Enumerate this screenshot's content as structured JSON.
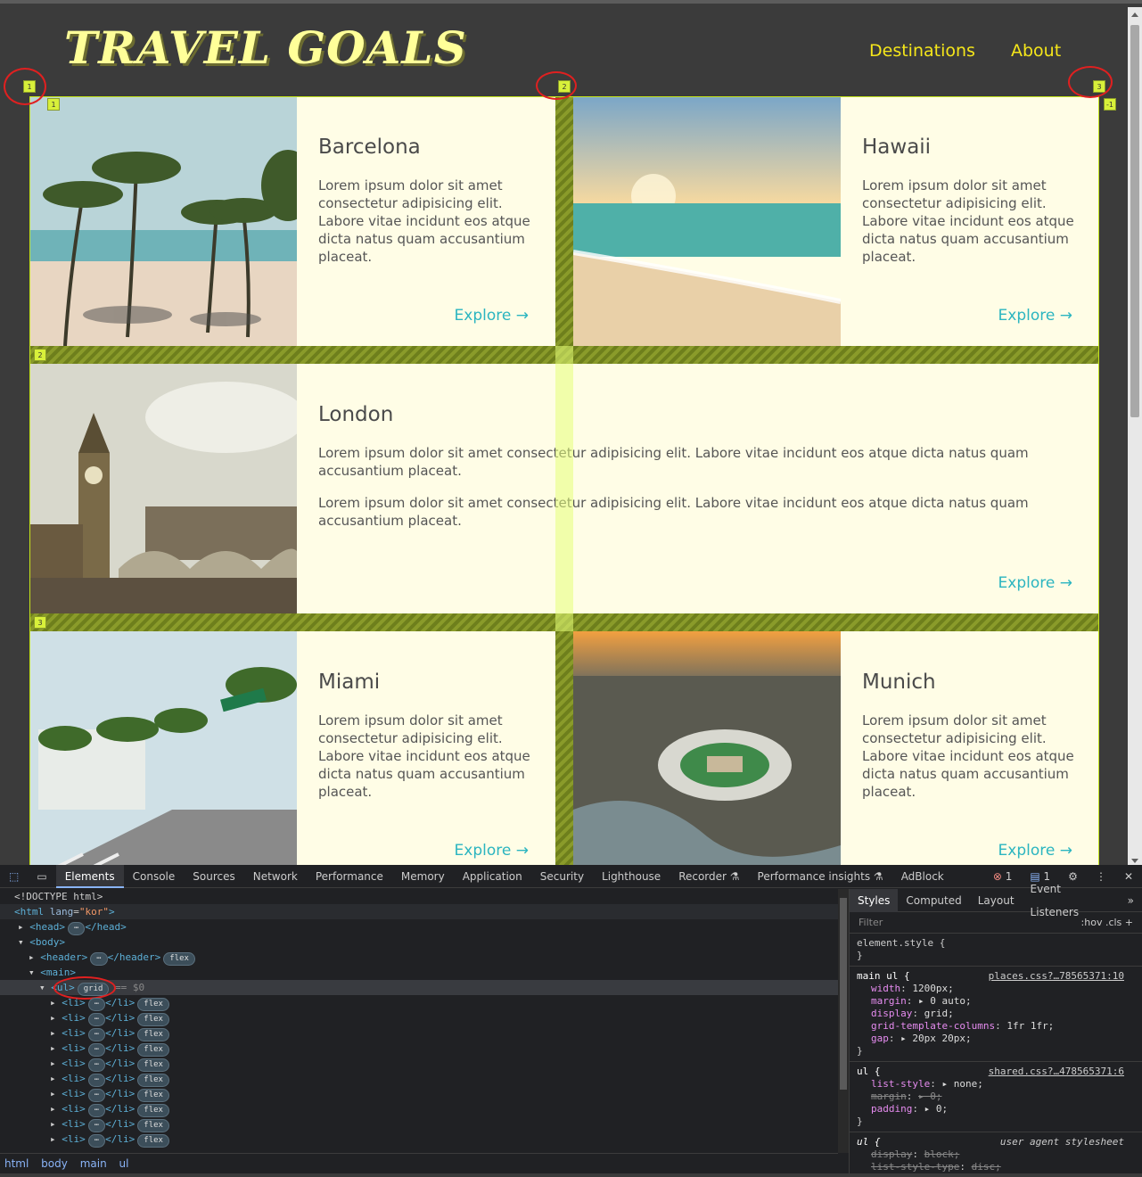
{
  "site": {
    "logo": "TRAVEL GOALS",
    "nav": [
      "Destinations",
      "About"
    ]
  },
  "cards": [
    {
      "title": "Barcelona",
      "text": [
        "Lorem ipsum dolor sit amet consectetur adipisicing elit. Labore vitae incidunt eos atque dicta natus quam accusantium placeat."
      ],
      "cta": "Explore →"
    },
    {
      "title": "Hawaii",
      "text": [
        "Lorem ipsum dolor sit amet consectetur adipisicing elit. Labore vitae incidunt eos atque dicta natus quam accusantium placeat."
      ],
      "cta": "Explore →"
    },
    {
      "title": "London",
      "text": [
        "Lorem ipsum dolor sit amet consectetur adipisicing elit. Labore vitae incidunt eos atque dicta natus quam accusantium placeat.",
        "Lorem ipsum dolor sit amet consectetur adipisicing elit. Labore vitae incidunt eos atque dicta natus quam accusantium placeat."
      ],
      "cta": "Explore →"
    },
    {
      "title": "Miami",
      "text": [
        "Lorem ipsum dolor sit amet consectetur adipisicing elit. Labore vitae incidunt eos atque dicta natus quam accusantium placeat."
      ],
      "cta": "Explore →"
    },
    {
      "title": "Munich",
      "text": [
        "Lorem ipsum dolor sit amet consectetur adipisicing elit. Labore vitae incidunt eos atque dicta natus quam accusantium placeat."
      ],
      "cta": "Explore →"
    }
  ],
  "grid_badges": {
    "col1": "1",
    "col2": "2",
    "col3": "3",
    "colneg": "-1",
    "row1": "1",
    "row2": "2",
    "row3": "3"
  },
  "devtools": {
    "tabs": [
      "Elements",
      "Console",
      "Sources",
      "Network",
      "Performance",
      "Memory",
      "Application",
      "Security",
      "Lighthouse",
      "Recorder ⚗",
      "Performance insights ⚗",
      "AdBlock"
    ],
    "active_tab": "Elements",
    "error_count": "1",
    "message_count": "1",
    "dom": {
      "doctype": "<!DOCTYPE html>",
      "html_tag": "<html",
      "lang_attr": "lang",
      "lang_val": "\"kor\"",
      "head": "<head>",
      "head_close": "</head>",
      "body": "<body>",
      "header": "<header>",
      "header_close": "</header>",
      "flex_pill": "flex",
      "main": "<main>",
      "ul": "<ul>",
      "grid_pill": "grid",
      "selected_suffix": "== $0",
      "li_open": "<li>",
      "li_close": "</li>",
      "ellipsis": "⋯",
      "li_count": 10
    },
    "breadcrumbs": [
      "html",
      "body",
      "main",
      "ul"
    ],
    "styles": {
      "tabs": [
        "Styles",
        "Computed",
        "Layout",
        "Event Listeners",
        "»"
      ],
      "filter_placeholder": "Filter",
      "filter_tools": ":hov  .cls  +",
      "element_style": "element.style {",
      "rule1_selector": "main ul {",
      "rule1_source": "places.css?…78565371:10",
      "rule1_props": [
        {
          "name": "width",
          "value": "1200px;"
        },
        {
          "name": "margin",
          "value": "▸ 0 auto;"
        },
        {
          "name": "display",
          "value": "grid;"
        },
        {
          "name": "grid-template-columns",
          "value": "1fr 1fr;"
        },
        {
          "name": "gap",
          "value": "▸ 20px 20px;"
        }
      ],
      "rule2_selector": "ul {",
      "rule2_source": "shared.css?…478565371:6",
      "rule2_props": [
        {
          "name": "list-style",
          "value": "▸ none;",
          "strike": false
        },
        {
          "name": "margin",
          "value": "▸ 0;",
          "strike": true
        },
        {
          "name": "padding",
          "value": "▸ 0;",
          "strike": false
        }
      ],
      "rule3_selector": "ul {",
      "rule3_source": "user agent stylesheet",
      "rule3_props": [
        {
          "name": "display",
          "value": "block;"
        },
        {
          "name": "list-style-type",
          "value": "disc;"
        }
      ],
      "close_brace": "}"
    }
  },
  "colors": {
    "accent": "#2bb5c0",
    "logo": "#ffff99",
    "nav": "#f5e61a",
    "card_bg": "#fffde6"
  }
}
